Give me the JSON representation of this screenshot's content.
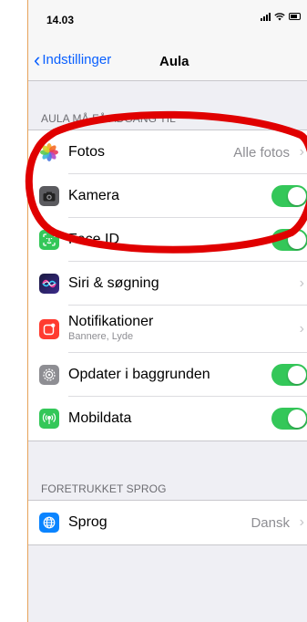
{
  "status": {
    "time": "14.03"
  },
  "nav": {
    "back_label": "Indstillinger",
    "title": "Aula"
  },
  "section1": {
    "header": "AULA MÅ FÅ ADGANG TIL",
    "rows": [
      {
        "label": "Fotos",
        "value": "Alle fotos",
        "icon": "photos-icon",
        "icon_color": "#ffffff"
      },
      {
        "label": "Kamera",
        "icon": "camera-icon",
        "icon_color": "#5b5b5f",
        "toggle": true
      },
      {
        "label": "Face ID",
        "icon": "face-id-icon",
        "icon_color": "#34c759",
        "toggle": true
      },
      {
        "label": "Siri & søgning",
        "icon": "siri-icon",
        "icon_color": "#2b2d7a"
      },
      {
        "label": "Notifikationer",
        "sublabel": "Bannere, Lyde",
        "icon": "notifications-icon",
        "icon_color": "#ff3b30"
      },
      {
        "label": "Opdater i baggrunden",
        "icon": "gear-icon",
        "icon_color": "#8e8e93",
        "toggle": true
      },
      {
        "label": "Mobildata",
        "icon": "cellular-icon",
        "icon_color": "#34c759",
        "toggle": true
      }
    ]
  },
  "section2": {
    "header": "FORETRUKKET SPROG",
    "rows": [
      {
        "label": "Sprog",
        "value": "Dansk",
        "icon": "globe-icon",
        "icon_color": "#0a84ff"
      }
    ]
  },
  "colors": {
    "accent": "#0a60ff",
    "toggle_on": "#34c759",
    "annotation": "#e00000"
  }
}
